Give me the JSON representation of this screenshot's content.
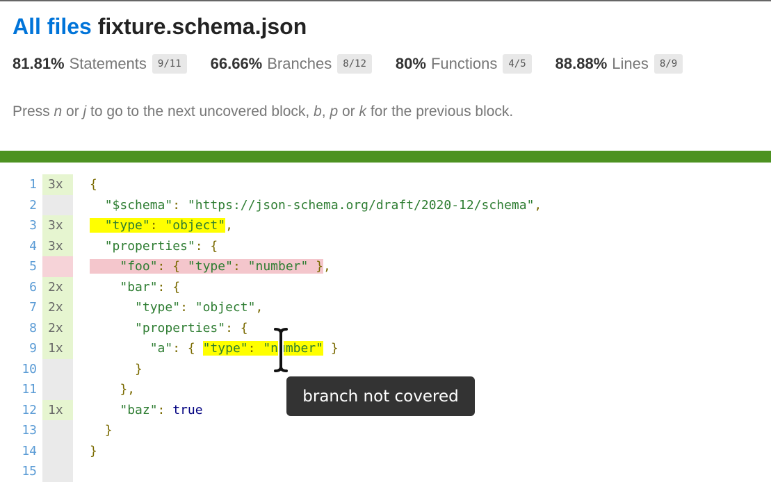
{
  "header": {
    "all_files_label": "All files",
    "file_name": "fixture.schema.json"
  },
  "stats": [
    {
      "pct": "81.81%",
      "label": "Statements",
      "fraction": "9/11"
    },
    {
      "pct": "66.66%",
      "label": "Branches",
      "fraction": "8/12"
    },
    {
      "pct": "80%",
      "label": "Functions",
      "fraction": "4/5"
    },
    {
      "pct": "88.88%",
      "label": "Lines",
      "fraction": "8/9"
    }
  ],
  "hint": {
    "t1": "Press ",
    "k1": "n",
    "t2": " or ",
    "k2": "j",
    "t3": " to go to the next uncovered block, ",
    "k3": "b",
    "t4": ", ",
    "k4": "p",
    "t5": " or ",
    "k5": "k",
    "t6": " for the previous block."
  },
  "status_color": "#4d9221",
  "lines": [
    {
      "num": "1",
      "count": "3x",
      "coverage": "yes"
    },
    {
      "num": "2",
      "count": "",
      "coverage": "neutral"
    },
    {
      "num": "3",
      "count": "3x",
      "coverage": "yes"
    },
    {
      "num": "4",
      "count": "3x",
      "coverage": "yes"
    },
    {
      "num": "5",
      "count": "",
      "coverage": "no"
    },
    {
      "num": "6",
      "count": "2x",
      "coverage": "yes"
    },
    {
      "num": "7",
      "count": "2x",
      "coverage": "yes"
    },
    {
      "num": "8",
      "count": "2x",
      "coverage": "yes"
    },
    {
      "num": "9",
      "count": "1x",
      "coverage": "yes"
    },
    {
      "num": "10",
      "count": "",
      "coverage": "neutral"
    },
    {
      "num": "11",
      "count": "",
      "coverage": "neutral"
    },
    {
      "num": "12",
      "count": "1x",
      "coverage": "yes"
    },
    {
      "num": "13",
      "count": "",
      "coverage": "neutral"
    },
    {
      "num": "14",
      "count": "",
      "coverage": "neutral"
    },
    {
      "num": "15",
      "count": "",
      "coverage": "neutral"
    }
  ],
  "code": {
    "open_brace": "{",
    "close_brace": "}",
    "colon": ": ",
    "comma": ",",
    "schema_key": "\"$schema\"",
    "schema_val": "\"https://json-schema.org/draft/2020-12/schema\"",
    "type_key": "\"type\"",
    "object_val": "\"object\"",
    "properties_key": "\"properties\"",
    "foo_key": "\"foo\"",
    "number_val": "\"number\"",
    "bar_key": "\"bar\"",
    "a_key": "\"a\"",
    "baz_key": "\"baz\"",
    "true_val": "true",
    "brace_open_sp": "{ ",
    "brace_close_sp": " }",
    "brace_close_comma": "},"
  },
  "tooltip": "branch not covered",
  "icons": {
    "cursor": "text-cursor-icon"
  }
}
